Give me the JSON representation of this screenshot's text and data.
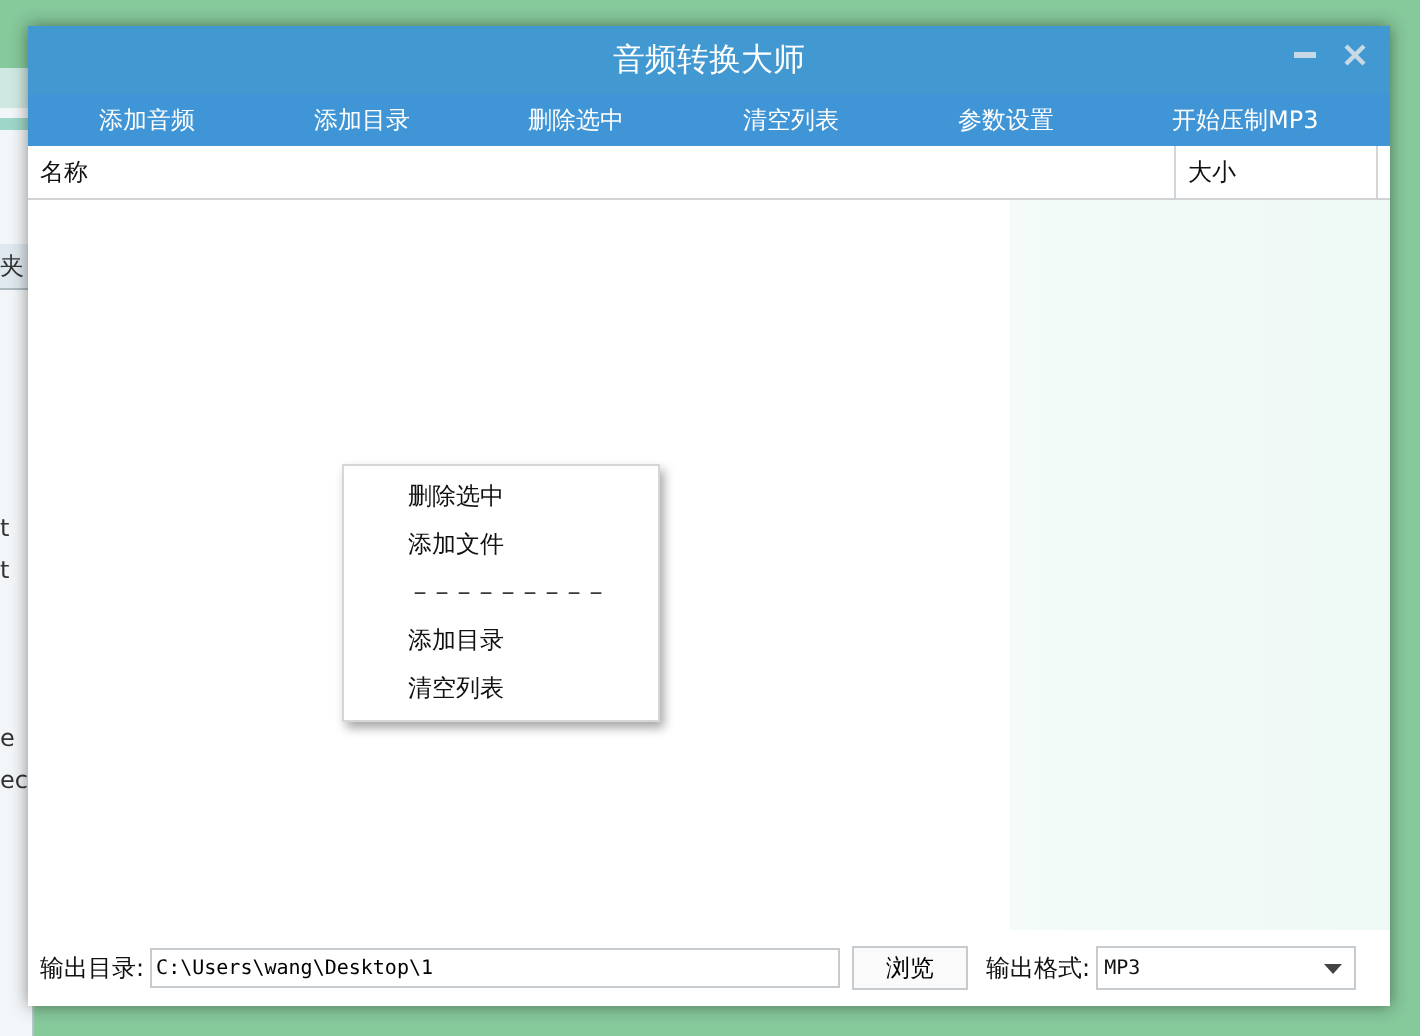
{
  "background_window": {
    "fragments": [
      {
        "text": "夹",
        "kind": "tab"
      },
      {
        "text": "t",
        "kind": "row"
      },
      {
        "text": "t",
        "kind": "row"
      },
      {
        "text": "e",
        "kind": "row"
      },
      {
        "text": "ec",
        "kind": "row"
      }
    ]
  },
  "window": {
    "title": "音频转换大师"
  },
  "toolbar": [
    "添加音频",
    "添加目录",
    "删除选中",
    "清空列表",
    "参数设置",
    "开始压制MP3"
  ],
  "table": {
    "columns": [
      "名称",
      "大小"
    ]
  },
  "context_menu": {
    "items": [
      {
        "kind": "item",
        "label": "删除选中"
      },
      {
        "kind": "item",
        "label": "添加文件"
      },
      {
        "kind": "separator",
        "label": "－－－－－－－－－"
      },
      {
        "kind": "item",
        "label": "添加目录"
      },
      {
        "kind": "item",
        "label": "清空列表"
      }
    ]
  },
  "output": {
    "dir_label": "输出目录:",
    "dir_value": "C:\\Users\\wang\\Desktop\\1",
    "browse": "浏览",
    "format_label": "输出格式:",
    "format_value": "MP3"
  }
}
